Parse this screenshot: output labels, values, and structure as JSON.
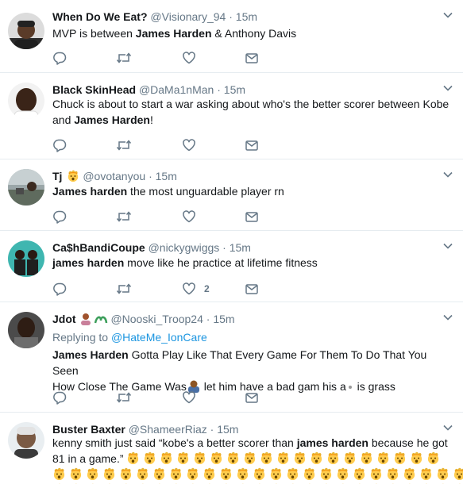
{
  "tweets": [
    {
      "name": "When Do We Eat?",
      "handle": "@Visionary_94",
      "sep": "·",
      "time": "15m",
      "text_parts": [
        "MVP is between ",
        "James Harden",
        " & Anthony Davis"
      ],
      "likes": ""
    },
    {
      "name": "Black SkinHead",
      "handle": "@DaMa1nMan",
      "sep": "·",
      "time": "15m",
      "line1_parts": [
        "Chuck is about to start a war asking about who's the better scorer between Kobe"
      ],
      "line2_parts": [
        "and ",
        "James Harden",
        "!"
      ],
      "likes": ""
    },
    {
      "name": "Tj",
      "handle": "@ovotanyou",
      "sep": "·",
      "time": "15m",
      "text_parts": [
        "James harden",
        " the most unguardable player rn"
      ],
      "likes": ""
    },
    {
      "name": "Ca$hBandiCoupe",
      "handle": "@nickygwiggs",
      "sep": "·",
      "time": "15m",
      "text_parts": [
        "james harden",
        " move like he practice at lifetime fitness"
      ],
      "likes": "2"
    },
    {
      "name": "Jdot",
      "handle": "@Nooski_Troop24",
      "sep": "·",
      "time": "15m",
      "replying_label": "Replying to",
      "replying_handle": "@HateMe_IonCare",
      "line1_parts": [
        "James Harden",
        " Gotta Play Like That Every Game For Them To Do That You Seen"
      ],
      "line2_a": "How Close The Game Was",
      "line2_b": " let him have a bad gam his a",
      "line2_c": " is grass",
      "likes": ""
    },
    {
      "name": "Buster Baxter",
      "handle": "@ShameerRiaz",
      "sep": "·",
      "time": "15m",
      "line1_parts": [
        "kenny smith just said “kobe's a better scorer than ",
        "james harden",
        " because he got"
      ],
      "line2": "81 in a game.”",
      "likes": ""
    }
  ],
  "icons": {
    "reply": "reply-icon",
    "retweet": "retweet-icon",
    "like": "heart-icon",
    "dm": "envelope-icon",
    "caret": "chevron-down-icon",
    "emoji_shocked": "exploding-head-emoji"
  },
  "colors": {
    "text": "#14171a",
    "muted": "#657786",
    "link": "#1b95e0",
    "border": "#e6ecf0"
  }
}
